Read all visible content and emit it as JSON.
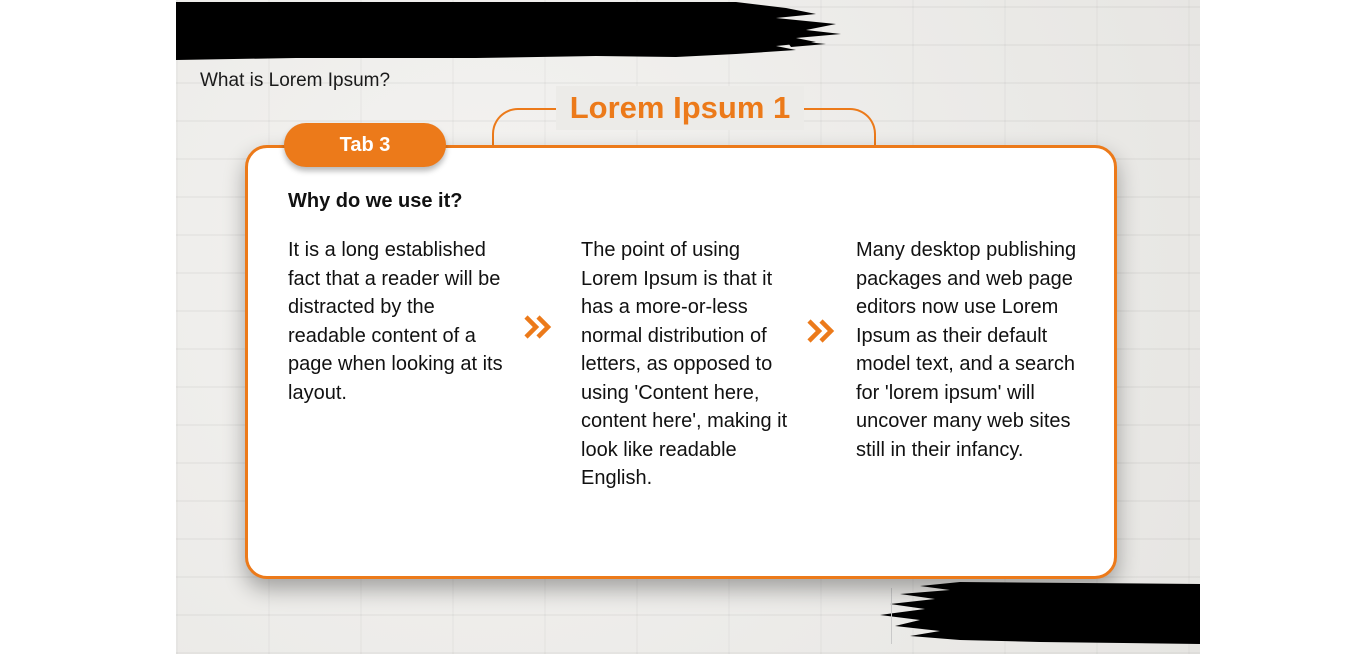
{
  "header": {
    "question": "What is Lorem Ipsum?",
    "title": "Lorem Ipsum 1"
  },
  "tab": {
    "label": "Tab 3"
  },
  "content": {
    "subtitle": "Why do we use it?",
    "columns": [
      "It is a long established fact that a reader will be distracted by the readable content of a page when looking at its layout.",
      "The point of using Lorem Ipsum is that it has a more-or-less normal distribution of letters, as opposed to using 'Content here, content here', making it look like readable English.",
      "Many desktop publishing packages and web page editors now use Lorem Ipsum as their default model text, and a search for 'lorem ipsum' will uncover many web sites still in their infancy."
    ]
  },
  "icons": {
    "separator": "double-chevron-right-icon",
    "decoration": "brush-stroke"
  },
  "colors": {
    "accent": "#ec7a1a",
    "text": "#111111",
    "background": "#ecebe8",
    "card": "#ffffff",
    "brush": "#000000"
  }
}
